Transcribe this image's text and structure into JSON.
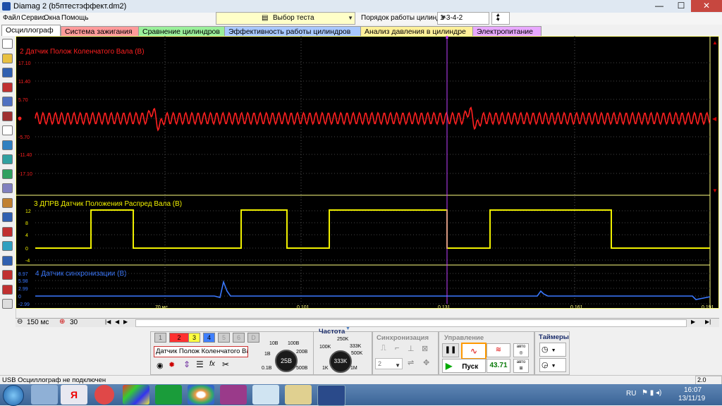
{
  "window": {
    "title": "Diamag 2 (b5птестэффект.dm2)",
    "minimize": "—",
    "maximize": "☐",
    "close": "✕"
  },
  "menu": [
    "Файл",
    "Сервис",
    "Окна",
    "Помощь"
  ],
  "toolbar": {
    "test_select": "Выбор теста",
    "order_label": "Порядок работы цилиндров",
    "order_value": "1-3-4-2",
    "cylinder_value": "1"
  },
  "tabs": [
    {
      "label": "Осциллограф",
      "color": "#ffffff"
    },
    {
      "label": "Система зажигания",
      "color": "#ff9a9a"
    },
    {
      "label": "Сравнение цилиндров",
      "color": "#9aef9a"
    },
    {
      "label": "Эффективность работы цилиндров",
      "color": "#a8c8ff"
    },
    {
      "label": "Анализ давления в цилиндре",
      "color": "#fff09a"
    },
    {
      "label": "Электропитание",
      "color": "#e8a8ff"
    }
  ],
  "channels": {
    "ch2": {
      "label": "2 Датчик Полож Коленчатого Вала (В)",
      "color": "#ff2020",
      "ticks": [
        "17.10",
        "11.40",
        "5.70",
        "0",
        "-5.70",
        "-11.40",
        "-17.10"
      ]
    },
    "ch3": {
      "label": "3 ДПРВ Датчик Положения Распред Вала (В)",
      "color": "#f0f000",
      "ticks": [
        "12",
        "8",
        "4",
        "0",
        "-4"
      ]
    },
    "ch4": {
      "label": "4 Датчик синхронизации (В)",
      "color": "#3a78ff",
      "ticks": [
        "8.97",
        "5.98",
        "2.99",
        "0",
        "-2.99"
      ]
    }
  },
  "time_axis": {
    "ticks": [
      "70 мс",
      "0.101",
      "0.131",
      "0.161",
      "0.191"
    ]
  },
  "scale": {
    "time": "150 мс",
    "zoom": "30"
  },
  "channel_selector": {
    "buttons": [
      "1",
      "2",
      "3",
      "4",
      "5",
      "6",
      "D"
    ],
    "active_channel_name": "Датчик Полож Коленчатого Ва..."
  },
  "voltage": {
    "value": "25В",
    "marks": [
      "10В",
      "100В",
      "1В",
      "200В",
      "0.1В",
      "500В"
    ]
  },
  "frequency": {
    "title": "Частота",
    "value": "333K",
    "marks": [
      "250K",
      "100K",
      "333K",
      "500K",
      "1K",
      "1M"
    ]
  },
  "sync": {
    "title": "Синхронизация",
    "value": "2"
  },
  "control": {
    "title": "Управление",
    "start": "Пуск",
    "freq_readout": "43.71",
    "auto1": "авто",
    "auto2": "авто"
  },
  "timers": {
    "title": "Таймеры"
  },
  "status": {
    "text": "USB Осциллограф не подключен",
    "version": "2.0"
  },
  "taskbar": {
    "lang": "RU",
    "time": "16:07",
    "date": "13/11/19"
  }
}
